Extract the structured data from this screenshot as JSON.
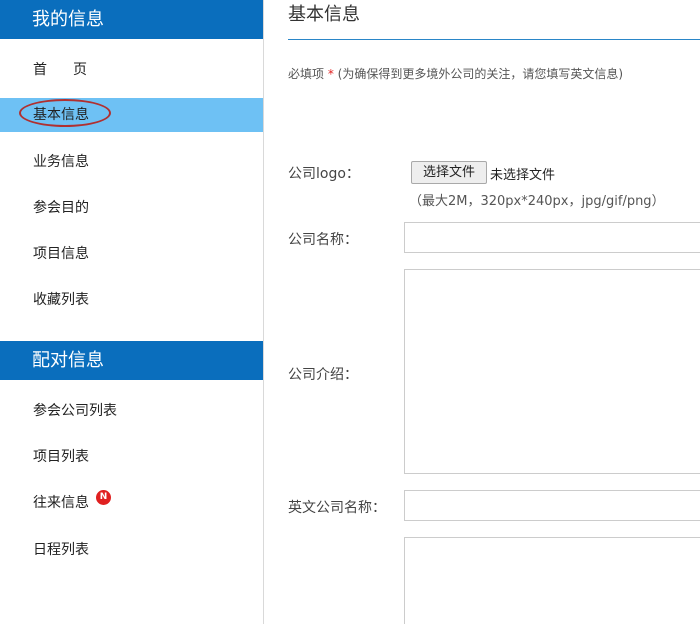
{
  "sidebar": {
    "my_info": {
      "header": "我的信息",
      "items": [
        {
          "label": "首页"
        },
        {
          "label": "基本信息",
          "active": true
        },
        {
          "label": "业务信息"
        },
        {
          "label": "参会目的"
        },
        {
          "label": "项目信息"
        },
        {
          "label": "收藏列表"
        }
      ]
    },
    "matching": {
      "header": "配对信息",
      "items": [
        {
          "label": "参会公司列表"
        },
        {
          "label": "项目列表"
        },
        {
          "label": "往来信息",
          "badge": "N"
        },
        {
          "label": "日程列表"
        }
      ]
    }
  },
  "main": {
    "title": "基本信息",
    "required_label": "必填项",
    "required_star": "*",
    "required_note": "(为确保得到更多境外公司的关注，请您填写英文信息)",
    "form": {
      "logo": {
        "label": "公司logo：",
        "button": "选择文件",
        "status": "未选择文件",
        "hint": "（最大2M，320px*240px，jpg/gif/png）"
      },
      "company_name": {
        "label": "公司名称：",
        "value": ""
      },
      "company_intro": {
        "label": "公司介绍：",
        "value": ""
      },
      "english_name": {
        "label": "英文公司名称：",
        "value": ""
      },
      "english_intro": {
        "value": ""
      }
    }
  },
  "colors": {
    "header_bg": "#0a6ebd",
    "active_bg": "#6ec1f4",
    "rule": "#2a86c8",
    "required": "#e02020",
    "highlight_ellipse": "#b03030",
    "badge": "#e02020"
  }
}
